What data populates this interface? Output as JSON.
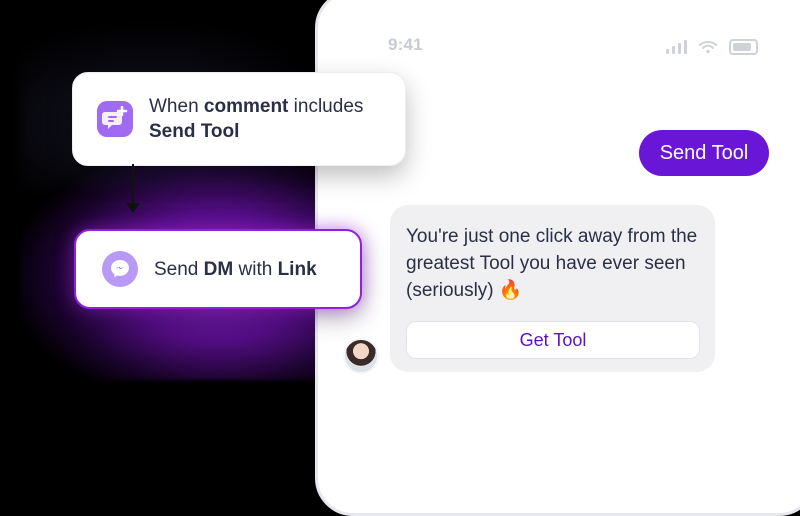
{
  "status_bar": {
    "time": "9:41"
  },
  "automation": {
    "trigger": {
      "icon": "comment-plus-icon",
      "prefix": "When ",
      "highlight": "comment",
      "suffix": " includes",
      "keyword": "Send Tool"
    },
    "action": {
      "icon": "messenger-icon",
      "prefix": "Send ",
      "highlight": "DM",
      "middle": " with ",
      "keyword": "Link"
    }
  },
  "chat": {
    "outgoing": "Send Tool",
    "incoming_text": "You're just one click away from the greatest Tool you have ever seen (seriously) 🔥",
    "cta_button": "Get Tool"
  },
  "colors": {
    "accent": "#6a16d6",
    "card_border": "#8f22d8",
    "bubble_bg": "#f0f0f3"
  }
}
